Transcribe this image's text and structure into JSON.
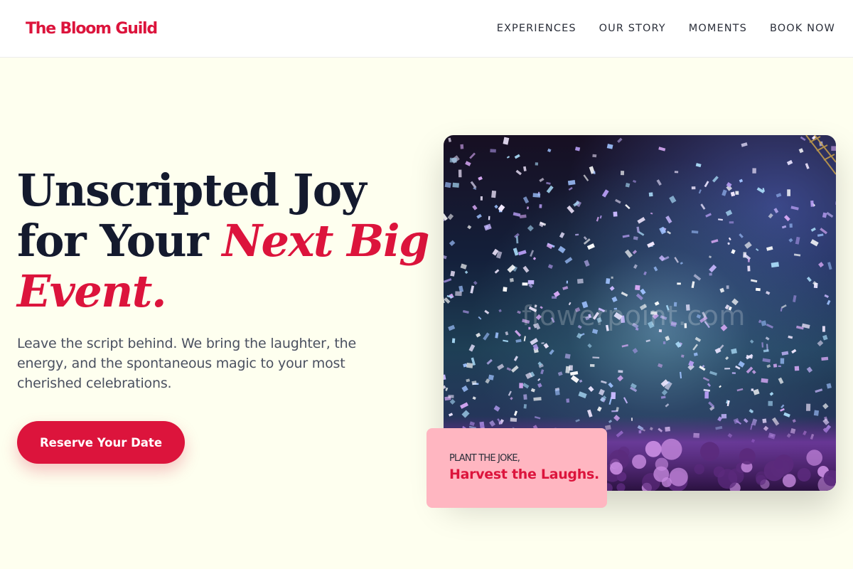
{
  "brand": {
    "logo_text": "The Bloom Guild",
    "accent_color": "#DC143C",
    "background_color": "#FEFFEF",
    "dark_text_color": "#141A2E",
    "card_color": "#FFB6C1"
  },
  "nav": {
    "items": [
      {
        "label": "EXPERIENCES"
      },
      {
        "label": "OUR STORY"
      },
      {
        "label": "MOMENTS"
      },
      {
        "label": "BOOK NOW"
      }
    ]
  },
  "hero": {
    "title_part1": "Unscripted Joy for Your ",
    "title_accent": "Next Big Event.",
    "subtitle": "Leave the script behind. We bring the laughter, the energy, and the spontaneous magic to your most cherished celebrations.",
    "cta_label": "Reserve Your Date",
    "image": {
      "description_icon": "confetti-concert-photo",
      "watermark_text": "flowerpoint.com"
    }
  },
  "card": {
    "eyebrow": "PLANT THE JOKE,",
    "title": "Harvest the Laughs."
  }
}
